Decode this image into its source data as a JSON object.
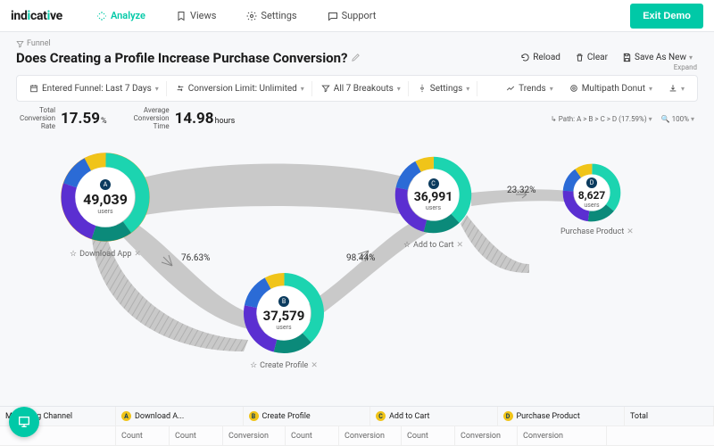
{
  "logo": {
    "pre": "ind",
    "mid": "i",
    "post": "cat",
    "tail": "i",
    "end": "ve"
  },
  "nav": {
    "analyze": "Analyze",
    "views": "Views",
    "settings": "Settings",
    "support": "Support",
    "exit": "Exit Demo"
  },
  "breadcrumb": "Funnel",
  "title": "Does Creating a Profile Increase Purchase Conversion?",
  "actions": {
    "reload": "Reload",
    "clear": "Clear",
    "save": "Save As New"
  },
  "filters": {
    "entered": "Entered Funnel: Last 7 Days",
    "limit": "Conversion Limit: Unlimited",
    "breakouts": "All 7 Breakouts",
    "settings": "Settings",
    "trends": "Trends",
    "viz": "Multipath Donut",
    "expand": "Expand"
  },
  "metrics": {
    "rate_lbl": "Total\nConversion\nRate",
    "rate_val": "17.59",
    "rate_unit": "%",
    "time_lbl": "Average\nConversion\nTime",
    "time_val": "14.98",
    "time_unit": "hours"
  },
  "path_ctrl": {
    "prefix": "Path:",
    "path": "A > B > C > D (17.59%)",
    "zoom": "100%"
  },
  "rates": {
    "ab": "76.63%",
    "bc": "98.44%",
    "cd": "23.32%"
  },
  "nodes": {
    "a": {
      "letter": "A",
      "value": "49,039",
      "users": "users",
      "label": "Download App"
    },
    "b": {
      "letter": "B",
      "value": "37,579",
      "users": "users",
      "label": "Create Profile"
    },
    "c": {
      "letter": "C",
      "value": "36,991",
      "users": "users",
      "label": "Add to Cart"
    },
    "d": {
      "letter": "D",
      "value": "8,627",
      "users": "users",
      "label": "Purchase Product"
    }
  },
  "table": {
    "h0": "Marketing Channel",
    "cols": [
      {
        "letter": "A",
        "label": "Download A..."
      },
      {
        "letter": "B",
        "label": "Create Profile"
      },
      {
        "letter": "C",
        "label": "Add to Cart"
      },
      {
        "letter": "D",
        "label": "Purchase Product"
      }
    ],
    "total": "Total",
    "count": "Count",
    "conv": "Conversion"
  },
  "chart_data": {
    "type": "funnel-donut",
    "title": "Does Creating a Profile Increase Purchase Conversion?",
    "total_conversion_rate_pct": 17.59,
    "avg_conversion_time_hours": 14.98,
    "steps": [
      {
        "id": "A",
        "label": "Download App",
        "users": 49039
      },
      {
        "id": "B",
        "label": "Create Profile",
        "users": 37579
      },
      {
        "id": "C",
        "label": "Add to Cart",
        "users": 36991
      },
      {
        "id": "D",
        "label": "Purchase Product",
        "users": 8627
      }
    ],
    "step_conversion_pct": {
      "A_to_B": 76.63,
      "B_to_C": 98.44,
      "C_to_D": 23.32
    },
    "breakout_dimension": "Marketing Channel",
    "breakout_count": 7
  }
}
